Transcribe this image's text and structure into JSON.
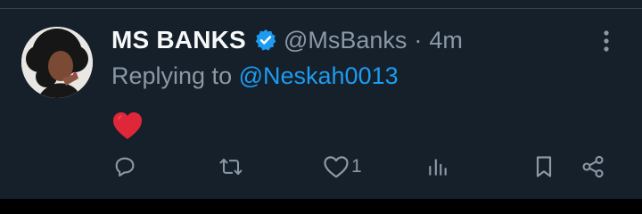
{
  "tweet": {
    "display_name": "MS BANKS",
    "handle": "@MsBanks",
    "separator": "·",
    "time": "4m",
    "reply_prefix": "Replying to ",
    "reply_to": "@Neskah0013",
    "content_emoji": "red-heart-emoji",
    "verified_icon": "verified-badge-icon"
  },
  "actions": {
    "reply": {
      "icon": "reply-icon"
    },
    "retweet": {
      "icon": "retweet-icon"
    },
    "like": {
      "icon": "like-icon",
      "count": "1"
    },
    "views": {
      "icon": "views-icon"
    },
    "bookmark": {
      "icon": "bookmark-icon"
    },
    "share": {
      "icon": "share-icon"
    }
  },
  "colors": {
    "background": "#15202b",
    "text": "#f7f9f9",
    "muted": "#8b98a5",
    "accent": "#1d9bf0",
    "heart": "#e0273a"
  }
}
